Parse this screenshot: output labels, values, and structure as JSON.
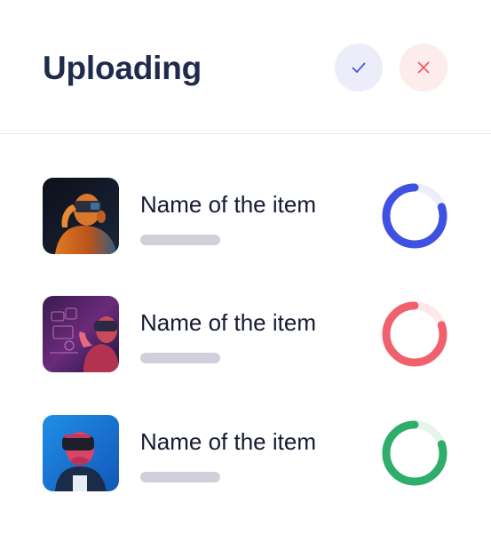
{
  "header": {
    "title": "Uploading",
    "confirm_icon": "check-icon",
    "cancel_icon": "close-icon"
  },
  "colors": {
    "title": "#1f2a4d",
    "confirm_bg": "#ecedf9",
    "confirm_icon": "#4a55d6",
    "cancel_bg": "#fdecec",
    "cancel_icon": "#ef5b6a",
    "placeholder_bar": "#cfd0db"
  },
  "items": [
    {
      "name": "Name of the item",
      "thumbnail": "vr-headset-photo-orange",
      "progress": 0.8,
      "ring_color": "#3f51e0",
      "ring_track": "#eceefb"
    },
    {
      "name": "Name of the item",
      "thumbnail": "vr-hologram-photo-purple",
      "progress": 0.8,
      "ring_color": "#f0606d",
      "ring_track": "#fde8ea"
    },
    {
      "name": "Name of the item",
      "thumbnail": "vr-headset-photo-blue",
      "progress": 0.8,
      "ring_color": "#2fad6b",
      "ring_track": "#e5f5ec"
    }
  ]
}
